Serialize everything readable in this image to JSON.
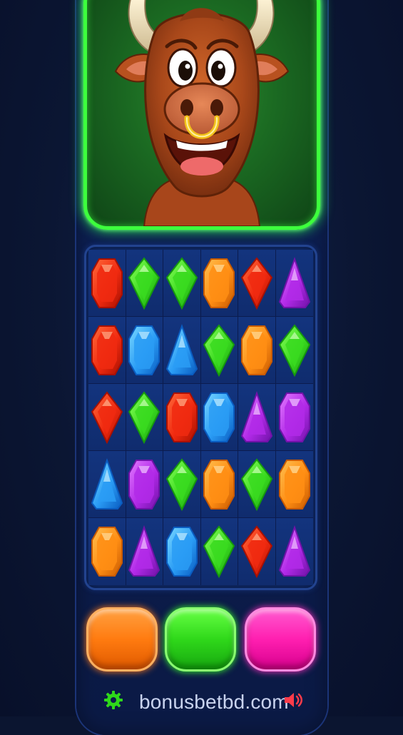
{
  "colors": {
    "frame_glow": "#3dff3d",
    "board": "#0f2a6b",
    "button_orange": "#ff7b10",
    "button_green": "#2fd81a",
    "button_pink": "#ff1fb0"
  },
  "character": {
    "icon": "bull-mascot-icon"
  },
  "board": {
    "rows": [
      [
        "red-hexagon-gem",
        "green-diamond-gem",
        "green-diamond-gem",
        "orange-hexagon-gem",
        "red-diamond-gem",
        "purple-triangle-gem"
      ],
      [
        "red-hexagon-gem",
        "blue-hexagon-gem",
        "blue-triangle-gem",
        "green-diamond-gem",
        "orange-hexagon-gem",
        "green-diamond-gem"
      ],
      [
        "red-diamond-gem",
        "green-diamond-gem",
        "red-hexagon-gem",
        "blue-hexagon-gem",
        "purple-triangle-gem",
        "purple-hexagon-gem"
      ],
      [
        "blue-triangle-gem",
        "purple-hexagon-gem",
        "green-diamond-gem",
        "orange-hexagon-gem",
        "green-diamond-gem",
        "orange-hexagon-gem"
      ],
      [
        "orange-hexagon-gem",
        "purple-triangle-gem",
        "blue-hexagon-gem",
        "green-diamond-gem",
        "red-diamond-gem",
        "purple-triangle-gem"
      ]
    ]
  },
  "buttons": [
    {
      "name": "orange-button",
      "color": "#ff7b10"
    },
    {
      "name": "green-button",
      "color": "#2fd81a"
    },
    {
      "name": "pink-button",
      "color": "#ff1fb0"
    }
  ],
  "footer": {
    "settings_icon": "gear-icon",
    "site_text": "bonusbetbd.com",
    "sound_icon": "speaker-icon"
  }
}
